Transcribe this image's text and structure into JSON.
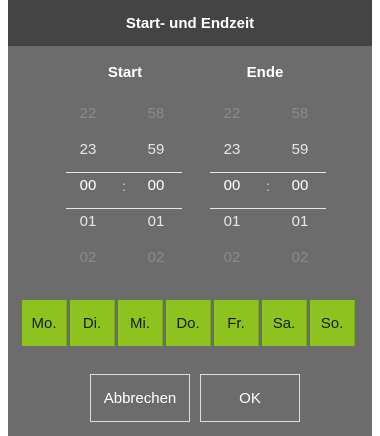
{
  "dialog": {
    "title": "Start- und Endzeit"
  },
  "start": {
    "label": "Start",
    "hours": [
      "22",
      "23",
      "00",
      "01",
      "02"
    ],
    "minutes": [
      "58",
      "59",
      "00",
      "01",
      "02"
    ],
    "separator": ":"
  },
  "end": {
    "label": "Ende",
    "hours": [
      "22",
      "23",
      "00",
      "01",
      "02"
    ],
    "minutes": [
      "58",
      "59",
      "00",
      "01",
      "02"
    ],
    "separator": ":"
  },
  "days": [
    "Mo.",
    "Di.",
    "Mi.",
    "Do.",
    "Fr.",
    "Sa.",
    "So."
  ],
  "buttons": {
    "cancel": "Abbrechen",
    "ok": "OK"
  },
  "colors": {
    "title_bar": "#444444",
    "dialog_bg": "#6c6c6c",
    "day_active": "#8dc21f"
  }
}
